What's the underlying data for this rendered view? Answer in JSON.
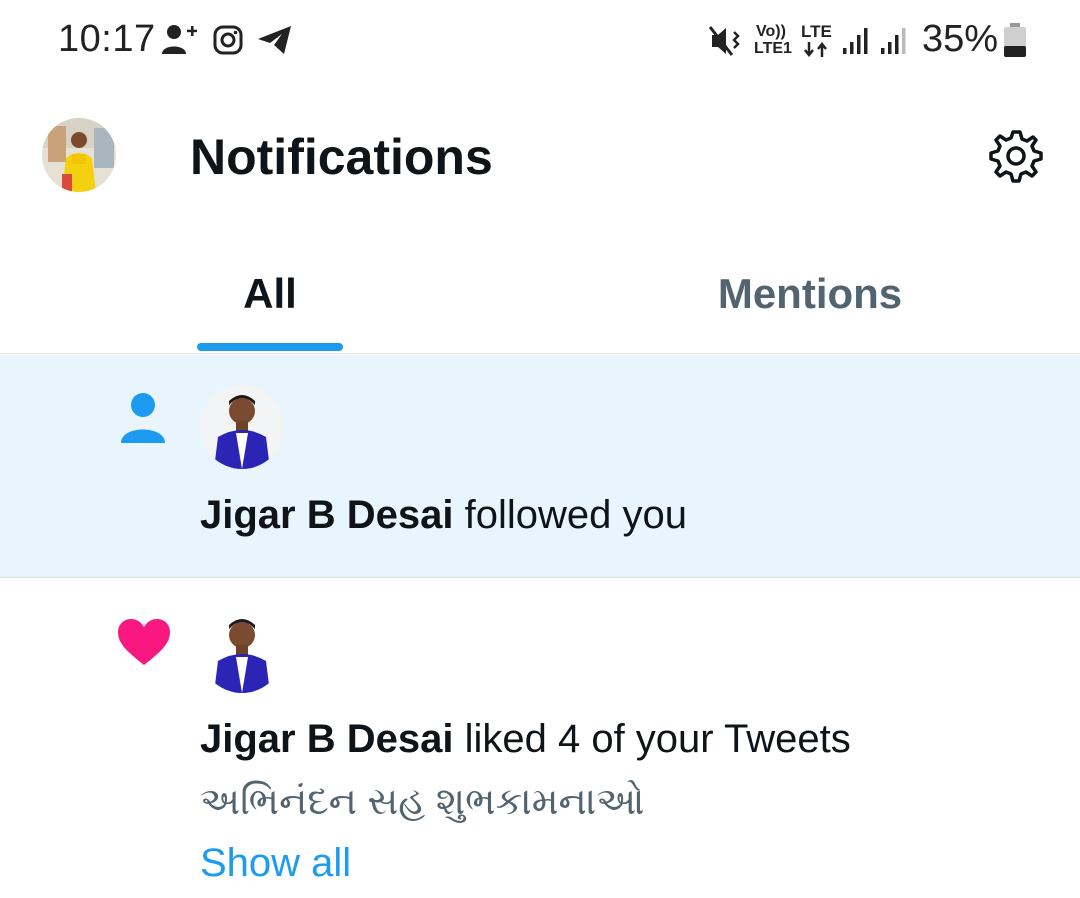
{
  "status_bar": {
    "time": "10:17",
    "left_icons": [
      "add-person-icon",
      "instagram-icon",
      "telegram-icon"
    ],
    "right_icons": [
      "mute-vibrate-icon",
      "volte-icon",
      "lte-data-icon",
      "signal-1-icon",
      "signal-2-icon",
      "battery-icon"
    ],
    "volte_line1": "Vo))",
    "volte_line2": "LTE1",
    "lte_label": "LTE",
    "battery_percent": "35%",
    "battery_level": 0.35
  },
  "header": {
    "title": "Notifications",
    "avatar_icon": "profile-avatar",
    "settings_icon": "gear-icon"
  },
  "tabs": [
    {
      "label": "All",
      "active": true
    },
    {
      "label": "Mentions",
      "active": false
    }
  ],
  "notifications": [
    {
      "type": "follow",
      "icon": "person-icon",
      "icon_color": "#1d9bf0",
      "user": "Jigar B Desai",
      "action": " followed you",
      "highlighted": true
    },
    {
      "type": "like",
      "icon": "heart-icon",
      "icon_color": "#f91880",
      "user": "Jigar B Desai",
      "action": " liked 4 of your Tweets",
      "tweet_text": "અભિનંદન સહ શુભકામનાઓ",
      "show_all": "Show all"
    }
  ],
  "colors": {
    "accent": "#1d9bf0",
    "highlight_bg": "#e8f5fd",
    "like": "#f91880",
    "muted_text": "#536471"
  }
}
